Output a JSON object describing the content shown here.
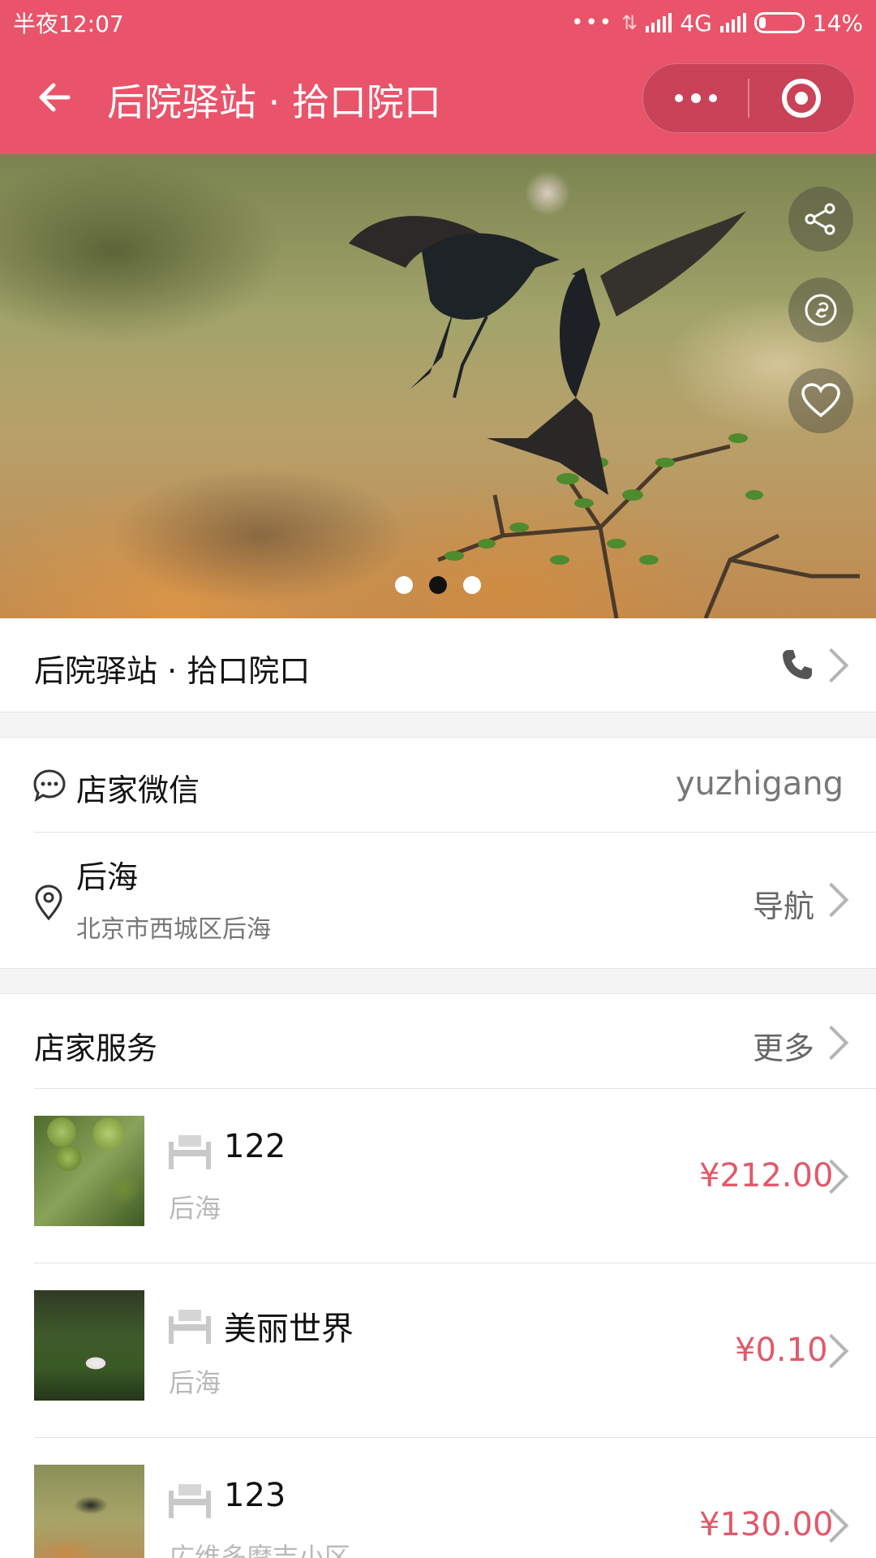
{
  "status_bar": {
    "time": "半夜12:07",
    "network": "4G",
    "battery": "14%"
  },
  "nav": {
    "title": "后院驿站 · 拾口院口"
  },
  "banner": {
    "page_count": 3,
    "active_page": 2
  },
  "shop": {
    "name": "后院驿站 · 拾口院口"
  },
  "contact": {
    "wechat_label": "店家微信",
    "wechat_id": "yuzhigang"
  },
  "location": {
    "name": "后海",
    "address": "北京市西城区后海",
    "nav_label": "导航"
  },
  "services": {
    "header": "店家服务",
    "more_label": "更多",
    "items": [
      {
        "name": "122",
        "location": "后海",
        "price": "¥212.00"
      },
      {
        "name": "美丽世界",
        "location": "后海",
        "price": "¥0.10"
      },
      {
        "name": "123",
        "location": "広维多摩吉小区",
        "price": "¥130.00"
      }
    ]
  },
  "colors": {
    "brand": "#e9546a",
    "price": "#e05a6a"
  }
}
